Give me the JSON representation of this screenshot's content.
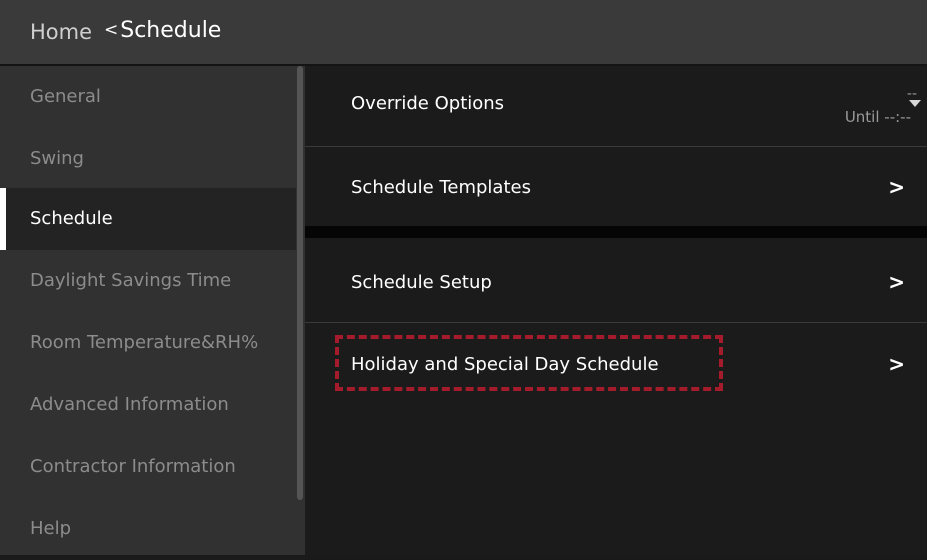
{
  "header": {
    "home_label": "Home",
    "back_chevron": "<",
    "title": "Schedule"
  },
  "sidebar": {
    "items": [
      {
        "label": "General",
        "active": false
      },
      {
        "label": "Swing",
        "active": false
      },
      {
        "label": "Schedule",
        "active": true
      },
      {
        "label": "Daylight Savings Time",
        "active": false
      },
      {
        "label": "Room Temperature&RH%",
        "active": false
      },
      {
        "label": "Advanced Information",
        "active": false
      },
      {
        "label": "Contractor Information",
        "active": false
      },
      {
        "label": "Help",
        "active": false
      }
    ]
  },
  "main": {
    "override": {
      "label": "Override Options",
      "value_top": "--",
      "value_until": "Until --:--"
    },
    "rows": [
      {
        "label": "Schedule Templates",
        "chevron": ">"
      },
      {
        "label": "Schedule Setup",
        "chevron": ">"
      },
      {
        "label": "Holiday and Special Day Schedule",
        "chevron": ">"
      }
    ]
  },
  "colors": {
    "highlight_box": "#a41c2b",
    "header_bg": "#3a3a3a",
    "sidebar_bg": "#313131",
    "main_bg": "#1b1b1b"
  },
  "icons": {
    "dropdown": "caret-down-icon",
    "chevron": "chevron-right-icon",
    "back": "chevron-left-icon"
  }
}
